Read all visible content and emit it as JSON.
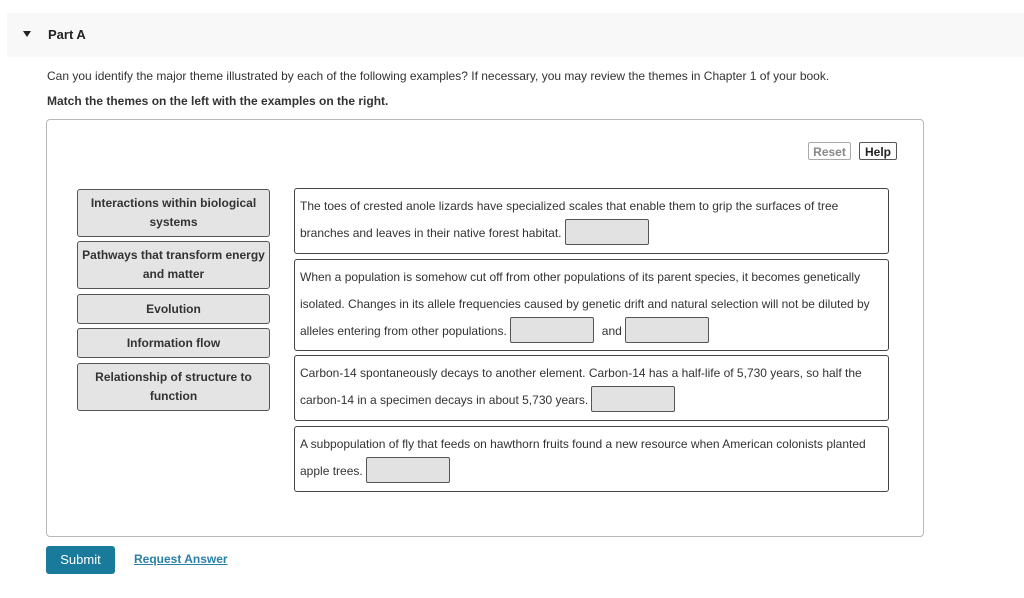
{
  "part": {
    "title": "Part A",
    "expanded_icon": "caret-down-icon"
  },
  "instructions": "Can you identify the major theme illustrated by each of the following examples? If necessary, you may review the themes in Chapter 1 of your book.",
  "subinstructions": "Match the themes on the left with the examples on the right.",
  "toolbar": {
    "reset_label": "Reset",
    "help_label": "Help"
  },
  "themes": [
    {
      "label": "Interactions within biological systems"
    },
    {
      "label": "Pathways that transform energy and matter"
    },
    {
      "label": "Evolution"
    },
    {
      "label": "Information flow"
    },
    {
      "label": "Relationship of structure to function"
    }
  ],
  "examples": [
    {
      "text": "The toes of crested anole lizards have specialized scales that enable them to grip the surfaces of tree branches and leaves in their native forest habitat.",
      "drop_targets": [
        ""
      ]
    },
    {
      "text": "When a population is somehow cut off from other populations of its parent species, it becomes genetically isolated. Changes in its allele frequencies caused by genetic drift and natural selection will not be diluted by alleles entering from other populations.",
      "connector": "and",
      "drop_targets": [
        "",
        ""
      ]
    },
    {
      "text": "Carbon-14 spontaneously decays to another element. Carbon-14 has a half-life of 5,730 years, so half the carbon-14 in a specimen decays in about 5,730 years.",
      "drop_targets": [
        ""
      ]
    },
    {
      "text": "A subpopulation of fly that feeds on hawthorn fruits found a new resource when American colonists planted apple trees.",
      "drop_targets": [
        ""
      ]
    }
  ],
  "actions": {
    "submit_label": "Submit",
    "request_answer_label": "Request Answer"
  },
  "colors": {
    "submit_bg": "#1a7a9b",
    "link": "#2a7fa6",
    "theme_bg": "#e4e4e4",
    "drop_bg": "#e2e2e2"
  }
}
